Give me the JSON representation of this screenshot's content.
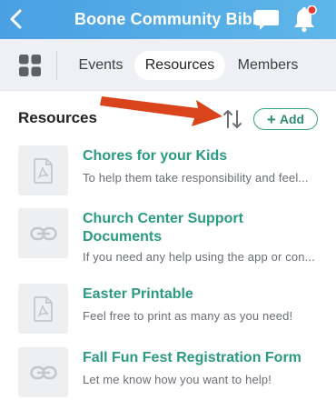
{
  "header": {
    "title": "Boone Community Bible",
    "back_icon": "chevron-left-icon",
    "chat_icon": "chat-bubble-icon",
    "bell_icon": "bell-icon",
    "notification_dot_color": "#e53935",
    "background_color": "#4aa0e2"
  },
  "tabs": {
    "apps_icon": "grid-icon",
    "items": [
      {
        "label": "Events",
        "selected": false
      },
      {
        "label": "Resources",
        "selected": true
      },
      {
        "label": "Members",
        "selected": false
      }
    ]
  },
  "section": {
    "title": "Resources",
    "sort_icon": "sort-arrows-icon",
    "add_label": "Add",
    "accent_color": "#3aa385"
  },
  "annotation": {
    "arrow_color": "#d9441c",
    "points_to": "sort-button"
  },
  "resources": [
    {
      "title": "Chores for your Kids",
      "description": "To help them take responsibility and feel...",
      "icon": "pdf-file-icon"
    },
    {
      "title": "Church Center Support Documents",
      "description": "If you need any help using the app or con...",
      "icon": "link-icon"
    },
    {
      "title": "Easter Printable",
      "description": "Feel free to print as many as you need!",
      "icon": "pdf-file-icon"
    },
    {
      "title": "Fall Fun Fest Registration Form",
      "description": "Let me know how you want to help!",
      "icon": "link-icon"
    }
  ]
}
